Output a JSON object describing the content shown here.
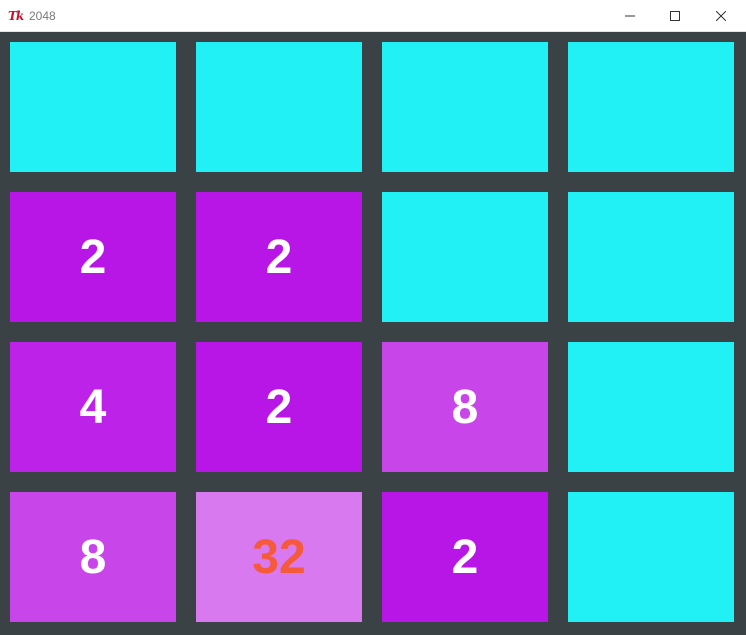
{
  "window": {
    "title": "2048",
    "icon_text": "Tk"
  },
  "colors": {
    "empty": "#21f1f5",
    "2": "#b816e6",
    "4": "#bc22e8",
    "8": "#c845ea",
    "32": "#d879f0",
    "board_background": "#3b4246",
    "text_light": "#ffffff",
    "text_32": "#f55a3a"
  },
  "board": {
    "rows": [
      [
        "",
        "",
        "",
        ""
      ],
      [
        "2",
        "2",
        "",
        ""
      ],
      [
        "4",
        "2",
        "8",
        ""
      ],
      [
        "8",
        "32",
        "2",
        ""
      ]
    ]
  }
}
